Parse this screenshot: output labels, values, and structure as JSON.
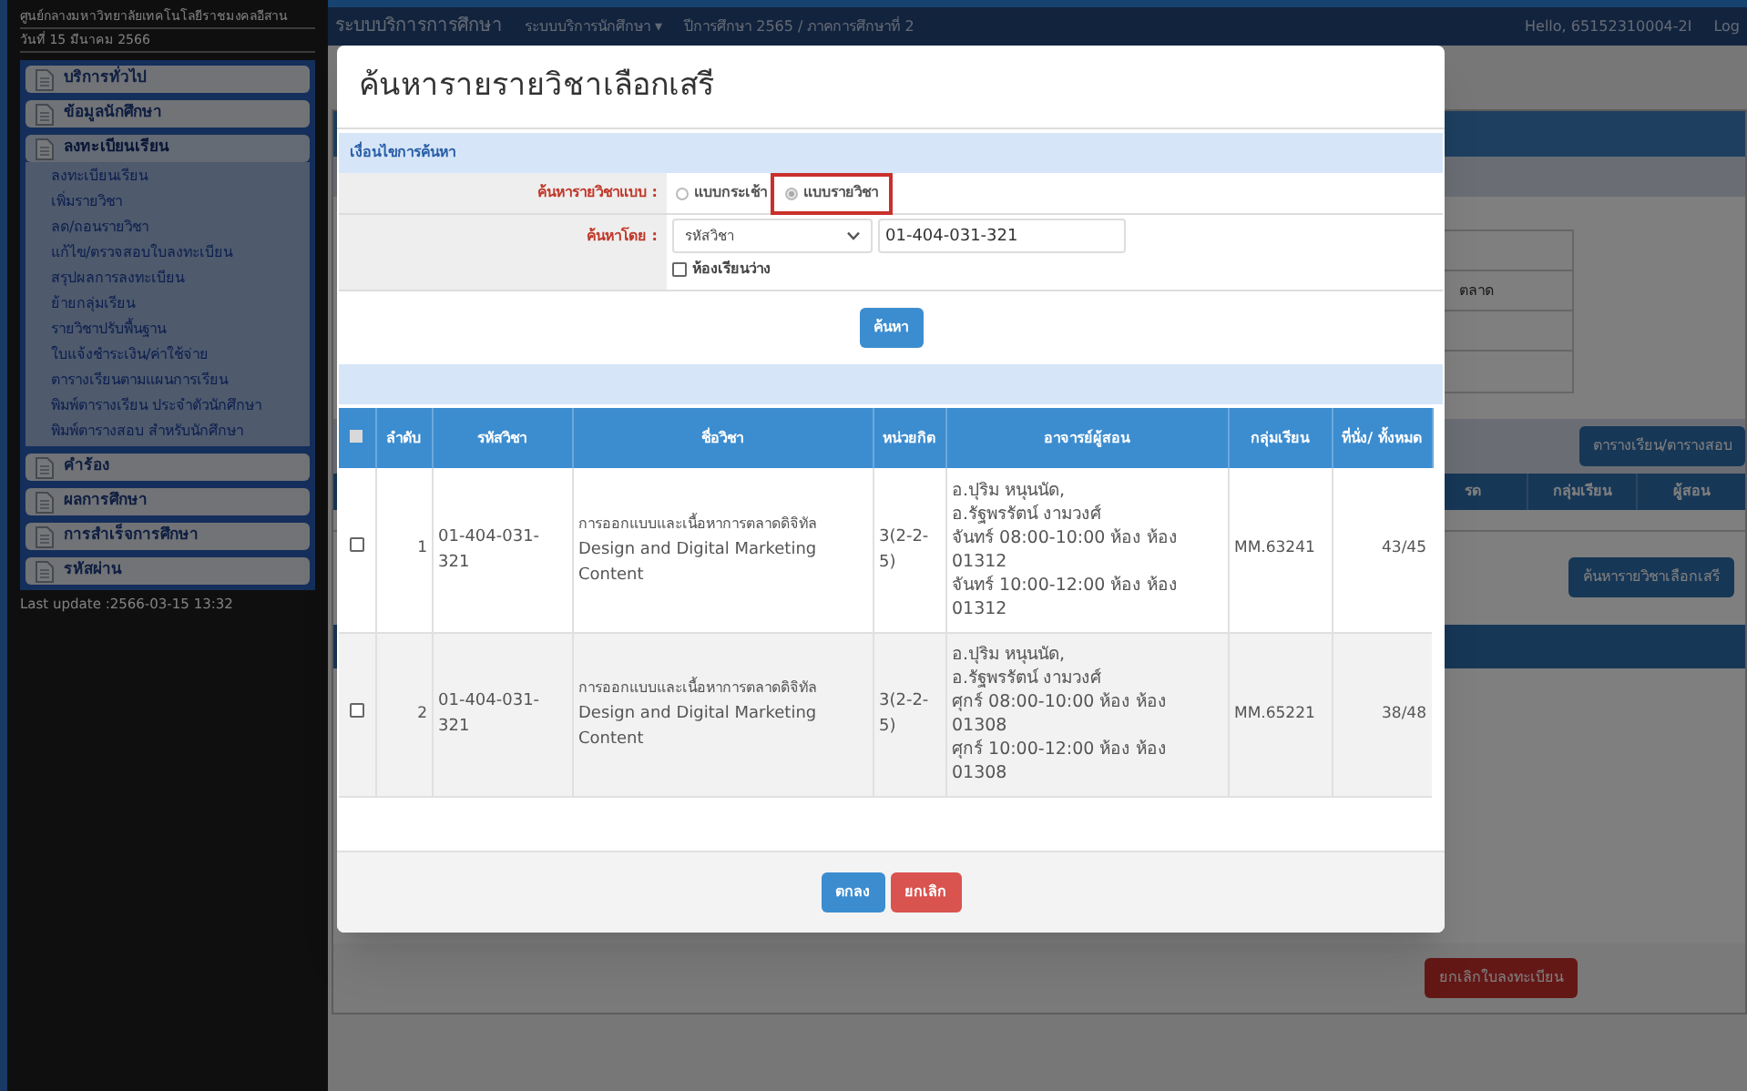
{
  "top_bar": {
    "system_title": "ระบบบริการการศึกษา",
    "menu": "ระบบบริการนักศึกษา ▾",
    "term": "ปีการศึกษา 2565 / ภาคการศึกษาที่ 2",
    "greeting": "Hello, 65152310004-2I",
    "logout": "Log"
  },
  "sidebar": {
    "university": "ศูนย์กลางมหาวิทยาลัยเทคโนโลยีราชมงคลอีสาน",
    "date": "วันที่ 15 มีนาคม 2566",
    "items": [
      {
        "label": "บริการทั่วไป",
        "expanded": false
      },
      {
        "label": "ข้อมูลนักศึกษา",
        "expanded": false
      },
      {
        "label": "ลงทะเบียนเรียน",
        "expanded": true,
        "children": [
          "ลงทะเบียนเรียน",
          "เพิ่มรายวิชา",
          "ลด/ถอนรายวิชา",
          "แก้ไข/ตรวจสอบใบลงทะเบียน",
          "สรุปผลการลงทะเบียน",
          "ย้ายกลุ่มเรียน",
          "รายวิชาปรับพื้นฐาน",
          "ใบแจ้งชำระเงิน/ค่าใช้จ่าย",
          "ตารางเรียนตามแผนการเรียน",
          "พิมพ์ตารางเรียน ประจำตัวนักศึกษา",
          "พิมพ์ตารางสอบ สำหรับนักศึกษา"
        ]
      },
      {
        "label": "คำร้อง",
        "expanded": false
      },
      {
        "label": "ผลการศึกษา",
        "expanded": false
      },
      {
        "label": "การสำเร็จการศึกษา",
        "expanded": false
      },
      {
        "label": "รหัสผ่าน",
        "expanded": false
      }
    ],
    "last_update": "Last update :2566-03-15 13:32"
  },
  "background_page": {
    "cell_text": "ตลาด",
    "schedule_button": "ตารางเรียน/ตารางสอบ",
    "columns": [
      "รด",
      "กลุ่มเรียน",
      "ผู้สอน"
    ],
    "search_button": "ค้นหารายวิชาเลือกเสรี",
    "cancel_button": "ยกเลิกใบลงทะเบียน"
  },
  "modal": {
    "title": "ค้นหารายรายวิชาเลือกเสรี",
    "section": "เงื่อนไขการค้นหา",
    "search_mode": {
      "label": "ค้นหารายวิชาแบบ :",
      "options": [
        {
          "label": "แบบกระเช้า",
          "selected": false,
          "highlighted": false
        },
        {
          "label": "แบบรายวิชา",
          "selected": true,
          "highlighted": true
        }
      ]
    },
    "search_by": {
      "label": "ค้นหาโดย :",
      "select": "รหัสวิชา",
      "value": "01-404-031-321",
      "checkbox": {
        "label": "ห้องเรียนว่าง",
        "checked": false
      }
    },
    "search_button": "ค้นหา",
    "table": {
      "select_all": false,
      "columns": [
        "ลำดับ",
        "รหัสวิชา",
        "ชื่อวิชา",
        "หน่วยกิต",
        "อาจารย์ผู้สอน",
        "กลุ่มเรียน",
        "ที่นั่ง/ ทั้งหมด"
      ],
      "rows": [
        {
          "checked": false,
          "no": "1",
          "code": "01-404-031-321",
          "name_th": "การออกแบบและเนื้อหาการตลาดดิจิทัล",
          "name_en": "Design and Digital Marketing Content",
          "credits": "3(2-2-5)",
          "instructors": [
            "อ.ปุริม หนุนนัด,",
            "อ.รัฐพรรัตน์ งามวงศ์",
            "จันทร์ 08:00-10:00 ห้อง ห้อง 01312",
            "จันทร์ 10:00-12:00 ห้อง ห้อง 01312"
          ],
          "group": "MM.63241",
          "seats": "43/45"
        },
        {
          "checked": false,
          "no": "2",
          "code": "01-404-031-321",
          "name_th": "การออกแบบและเนื้อหาการตลาดดิจิทัล",
          "name_en": "Design and Digital Marketing Content",
          "credits": "3(2-2-5)",
          "instructors": [
            "อ.ปุริม หนุนนัด,",
            "อ.รัฐพรรัตน์ งามวงศ์",
            "ศุกร์ 08:00-10:00 ห้อง ห้อง 01308",
            "ศุกร์ 10:00-12:00 ห้อง ห้อง 01308"
          ],
          "group": "MM.65221",
          "seats": "38/48"
        }
      ]
    },
    "buttons": [
      {
        "label": "ตกลง",
        "kind": "primary"
      },
      {
        "label": "ยกเลิก",
        "kind": "danger"
      }
    ]
  }
}
